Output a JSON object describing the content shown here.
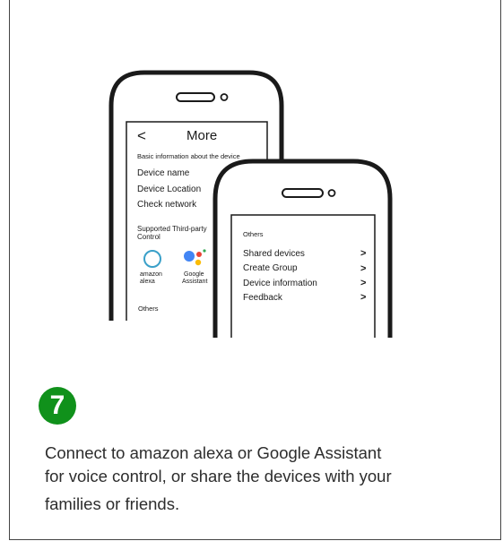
{
  "phone_back": {
    "back_glyph": "<",
    "title": "More",
    "section_basic": "Basic information about the device",
    "items": [
      "Device name",
      "Device Location",
      "Check network"
    ],
    "third_party_line1": "Supported Third-party",
    "third_party_line2": "Control",
    "alexa_line1": "amazon",
    "alexa_line2": "alexa",
    "google_line1": "Google",
    "google_line2": "Assistant",
    "others": "Others"
  },
  "phone_front": {
    "others": "Others",
    "items": [
      "Shared devices",
      "Create Group",
      "Device information",
      "Feedback"
    ],
    "chevron": ">"
  },
  "step": {
    "number": "7",
    "color": "#10911b",
    "lines": [
      "Connect to amazon alexa or Google Assistant",
      "for voice control, or share the devices with your",
      "families or friends."
    ]
  },
  "colors": {
    "alexa": "#3aa0c9",
    "google_blue": "#4285f4",
    "google_red": "#ea4335",
    "google_yellow": "#fbbc05",
    "google_green": "#34a853"
  }
}
